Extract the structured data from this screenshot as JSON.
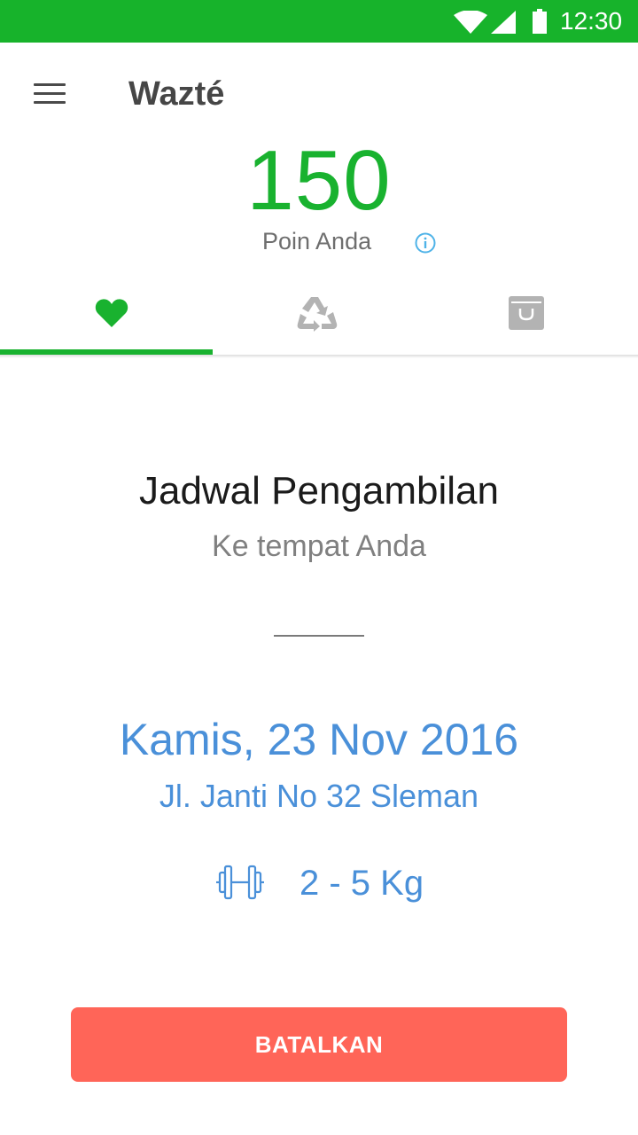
{
  "status_bar": {
    "time": "12:30",
    "icons": [
      "wifi-icon",
      "signal-icon",
      "battery-icon"
    ],
    "color": "#17b32b"
  },
  "header": {
    "title": "Wazté",
    "menu_icon": "hamburger-menu-icon"
  },
  "points": {
    "value": "150",
    "label": "Poin Anda",
    "info_icon": "info-icon"
  },
  "tabs": [
    {
      "icon": "heart-icon",
      "selected": true
    },
    {
      "icon": "recycle-icon",
      "selected": false
    },
    {
      "icon": "trash-bin-icon",
      "selected": false
    }
  ],
  "schedule": {
    "title": "Jadwal Pengambilan",
    "subtitle": "Ke tempat Anda",
    "date": "Kamis, 23 Nov 2016",
    "address": "Jl. Janti No 32 Sleman",
    "weight_icon": "dumbbell-icon",
    "weight": "2 - 5 Kg"
  },
  "actions": {
    "cancel_label": "BATALKAN"
  },
  "colors": {
    "brand_green": "#19b22f",
    "accent_blue": "#4a90d9",
    "cancel_red": "#ff6558",
    "inactive_icon": "#b3b3b3"
  }
}
